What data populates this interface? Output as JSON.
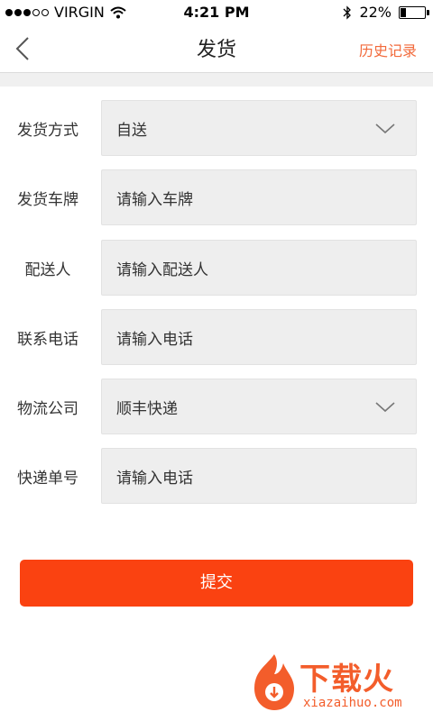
{
  "status_bar": {
    "carrier": "VIRGIN",
    "time": "4:21 PM",
    "battery_percent": "22%",
    "battery_level": 0.22,
    "icons": [
      "signal-dots-icon",
      "wifi-icon",
      "bluetooth-icon",
      "battery-icon"
    ]
  },
  "nav": {
    "title": "发货",
    "history_label": "历史记录",
    "back_icon": "chevron-left-icon"
  },
  "form": {
    "rows": [
      {
        "label": "发货方式",
        "value": "自送",
        "type": "select"
      },
      {
        "label": "发货车牌",
        "placeholder": "请输入车牌",
        "type": "input"
      },
      {
        "label": "配送人",
        "placeholder": "请输入配送人",
        "type": "input"
      },
      {
        "label": "联系电话",
        "placeholder": "请输入电话",
        "type": "input"
      },
      {
        "label": "物流公司",
        "value": "顺丰快递",
        "type": "select"
      },
      {
        "label": "快递单号",
        "placeholder": "请输入电话",
        "type": "input"
      }
    ]
  },
  "submit_label": "提交",
  "watermark": {
    "title": "下载火",
    "url": "xiazaihuo.com"
  },
  "colors": {
    "accent": "#fa4211",
    "history_link": "#f26a3b",
    "field_bg": "#eeeeee",
    "watermark": "#f35d2b"
  }
}
